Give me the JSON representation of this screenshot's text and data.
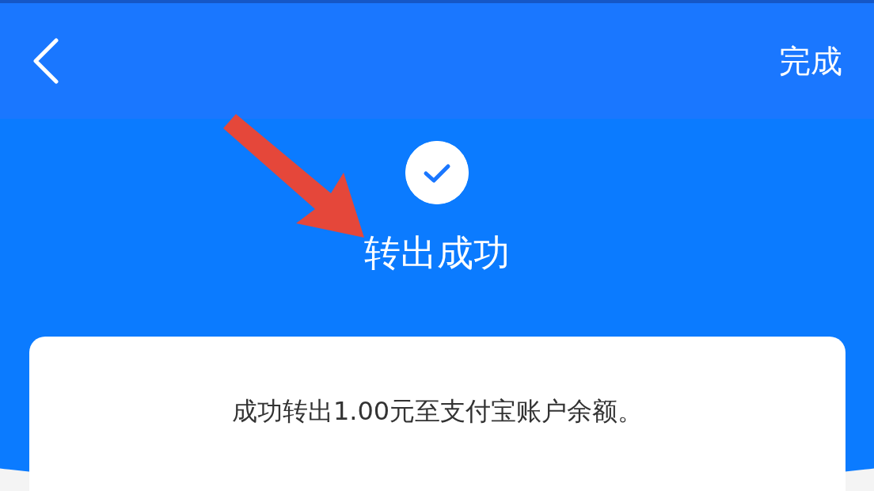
{
  "nav_bar": {
    "done_label": "完成"
  },
  "result": {
    "title": "转出成功"
  },
  "card": {
    "message": "成功转出1.00元至支付宝账户余额。"
  }
}
